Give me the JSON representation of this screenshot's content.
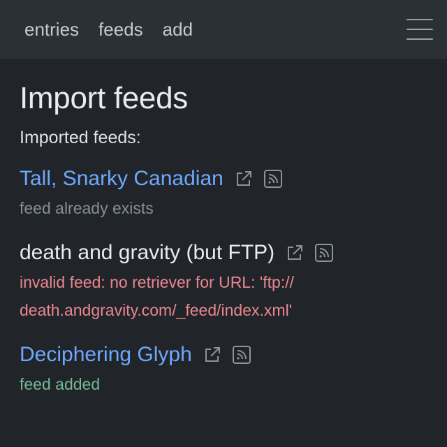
{
  "nav": {
    "links": [
      {
        "label": "entries"
      },
      {
        "label": "feeds"
      },
      {
        "label": "add"
      }
    ],
    "toggle_icon": "hamburger-menu-icon"
  },
  "main": {
    "title": "Import feeds",
    "subtitle": "Imported feeds:",
    "feeds": [
      {
        "title": "Tall, Snarky Canadian",
        "is_link": true,
        "status": "feed already exists",
        "status_type": "muted",
        "icons": [
          "external-link-icon",
          "rss-feed-icon"
        ]
      },
      {
        "title": "death and gravity (but FTP)",
        "is_link": false,
        "status_line1": "invalid feed: no retriever for URL: 'ftp://",
        "status_line2": "death.andgravity.com/_feed/index.xml'",
        "status_type": "error",
        "icons": [
          "external-link-icon",
          "rss-feed-icon"
        ]
      },
      {
        "title": "Deciphering Glyph",
        "is_link": true,
        "status": "feed added",
        "status_type": "success",
        "icons": [
          "external-link-icon",
          "rss-feed-icon"
        ]
      }
    ]
  },
  "colors": {
    "background": "#212529",
    "navbar": "#2b3035",
    "link": "#6ea8fe",
    "muted": "#868e96",
    "error": "#ea868f",
    "success": "#75b798"
  }
}
